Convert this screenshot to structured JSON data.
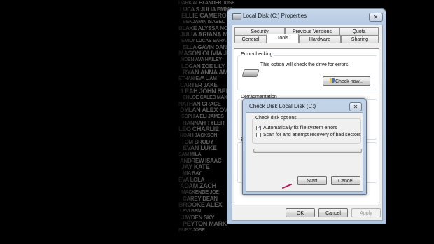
{
  "wallpaper": {
    "rows": [
      "DARK ALEXANDER JOSE",
      "LUCA S JULIA EMMA",
      "ELLIE CAMERON",
      "BENJAMIN ISABEL",
      "BLAKE ALYSSA NOAH",
      "JULIA ARIANA MIA",
      "EMILY LUCAS SARA",
      "ELLA GAVIN DANIEL",
      "MASON OLIVIA JACK",
      "AIDEN AVA HAILEY",
      "LOGAN ZOE LILY",
      "RYAN ANNA AMELIA",
      "ETHAN EVA LIAM",
      "CARTER JAKE",
      "LEAH JOHN BELLA",
      "CHLOE CALEB MAX",
      "NATHAN GRACE",
      "DYLAN ALEX OWEN",
      "SOPHIA ELI JAMES",
      "HANNAH TYLER",
      "LEO CHARLIE",
      "NOAH JACKSON",
      "TOM BRODY",
      "EVAN LUKE",
      "SAM MILA",
      "ANDREW ISAAC",
      "JAY KATE",
      "MIA RAY",
      "EVA LOLA",
      "ADAM ZACH",
      "MACKENZIE JOE",
      "CAREY DEAN",
      "BROOKE ALEX",
      "LEVI BEN",
      "JAYDEN SKY",
      "PEYTON MARK",
      "RUBY JOSE"
    ]
  },
  "props_window": {
    "title": "Local Disk (C:) Properties",
    "close": "✕",
    "tabs_top": [
      "Security",
      "Previous Versions",
      "Quota"
    ],
    "tabs_bottom": [
      "General",
      "Tools",
      "Hardware",
      "Sharing"
    ],
    "active_tab": "Tools",
    "error_checking": {
      "label": "Error-checking",
      "description": "This option will check the drive for errors.",
      "button": "Check now..."
    },
    "defrag": {
      "label": "Defragmentation"
    },
    "backup": {
      "label": "B"
    },
    "buttons": {
      "ok": "OK",
      "cancel": "Cancel",
      "apply": "Apply"
    }
  },
  "check_dialog": {
    "title": "Check Disk Local Disk (C:)",
    "close": "✕",
    "group_label": "Check disk options",
    "options": [
      {
        "label": "Automatically fix file system errors",
        "checked": true
      },
      {
        "label": "Scan for and attempt recovery of bad sectors",
        "checked": false
      }
    ],
    "progress": 0,
    "buttons": {
      "start": "Start",
      "cancel": "Cancel"
    }
  },
  "colors": {
    "window_frame": "#b8cbe2",
    "progress_green": "#37b04f",
    "cursor": "#c2185b"
  },
  "icons": [
    "drive-icon",
    "shield-icon",
    "checkmark-icon",
    "close-icon",
    "cursor-icon"
  ]
}
